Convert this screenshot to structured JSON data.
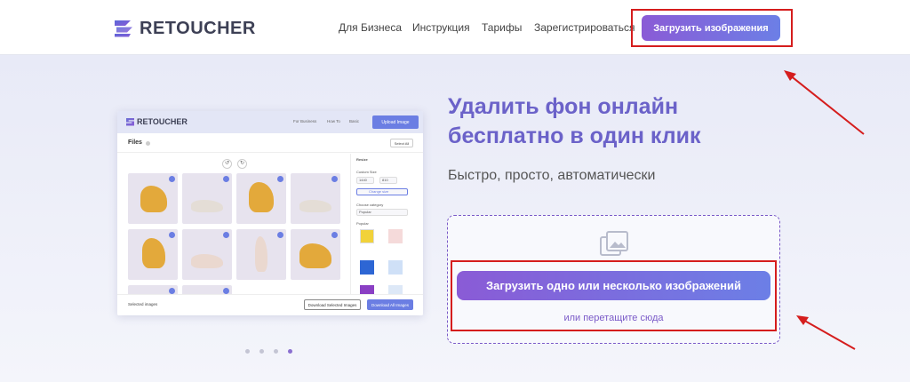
{
  "header": {
    "logo_text": "RETOUCHER",
    "nav": [
      "Для Бизнеса",
      "Инструкция",
      "Тарифы",
      "Зарегистрироваться"
    ],
    "upload_button": "Загрузить изображения"
  },
  "preview": {
    "logo_text": "RETOUCHER",
    "nav": [
      "For Business",
      "How To",
      "Basic"
    ],
    "upload_button": "Upload Image",
    "files_label": "Files",
    "select_all": "Select All",
    "side": {
      "resize": "Resize",
      "custom_size": "Custom Size",
      "w": "1440",
      "h": "810",
      "change_size": "Change size",
      "choose_category": "Choose category",
      "category_value": "Popular",
      "popular": "Popular"
    },
    "footer": {
      "selected": "Selected images",
      "download_selected": "Download Selected Images",
      "download_all": "Download All Images"
    }
  },
  "hero": {
    "title": "Удалить фон онлайн бесплатно в один клик",
    "subtitle": "Быстро, просто, автоматически"
  },
  "dropzone": {
    "button": "Загрузить одно или несколько изображений",
    "hint": "или перетащите сюда"
  },
  "carousel": {
    "count": 4,
    "active_index": 3
  },
  "colors": {
    "accent_start": "#8a5bd6",
    "accent_end": "#6c7fe6",
    "title": "#6b62c9",
    "annotation_red": "#d51d1d"
  }
}
